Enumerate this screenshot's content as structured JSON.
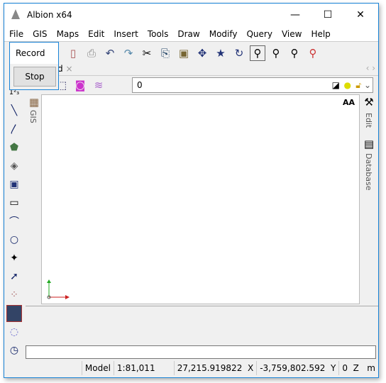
{
  "window": {
    "title": "Albion x64",
    "minimize": "—",
    "maximize": "☐",
    "close": "✕"
  },
  "menu": [
    "File",
    "GIS",
    "Maps",
    "Edit",
    "Insert",
    "Tools",
    "Draw",
    "Modify",
    "Query",
    "View",
    "Help"
  ],
  "popup": {
    "record_label": "Record",
    "stop_label": "Stop"
  },
  "tab": {
    "label": "d",
    "close": "×"
  },
  "layer": {
    "value": "0"
  },
  "side": {
    "gis": "GIS",
    "edit": "Edit",
    "database": "Database",
    "text_size": "AA"
  },
  "status": {
    "space": "Model",
    "scale": "1:81,011",
    "x": "27,215.919822",
    "x_label": "X",
    "y": "-3,759,802.592",
    "y_label": "Y",
    "z": "0",
    "z_label": "Z",
    "unit": "m"
  }
}
